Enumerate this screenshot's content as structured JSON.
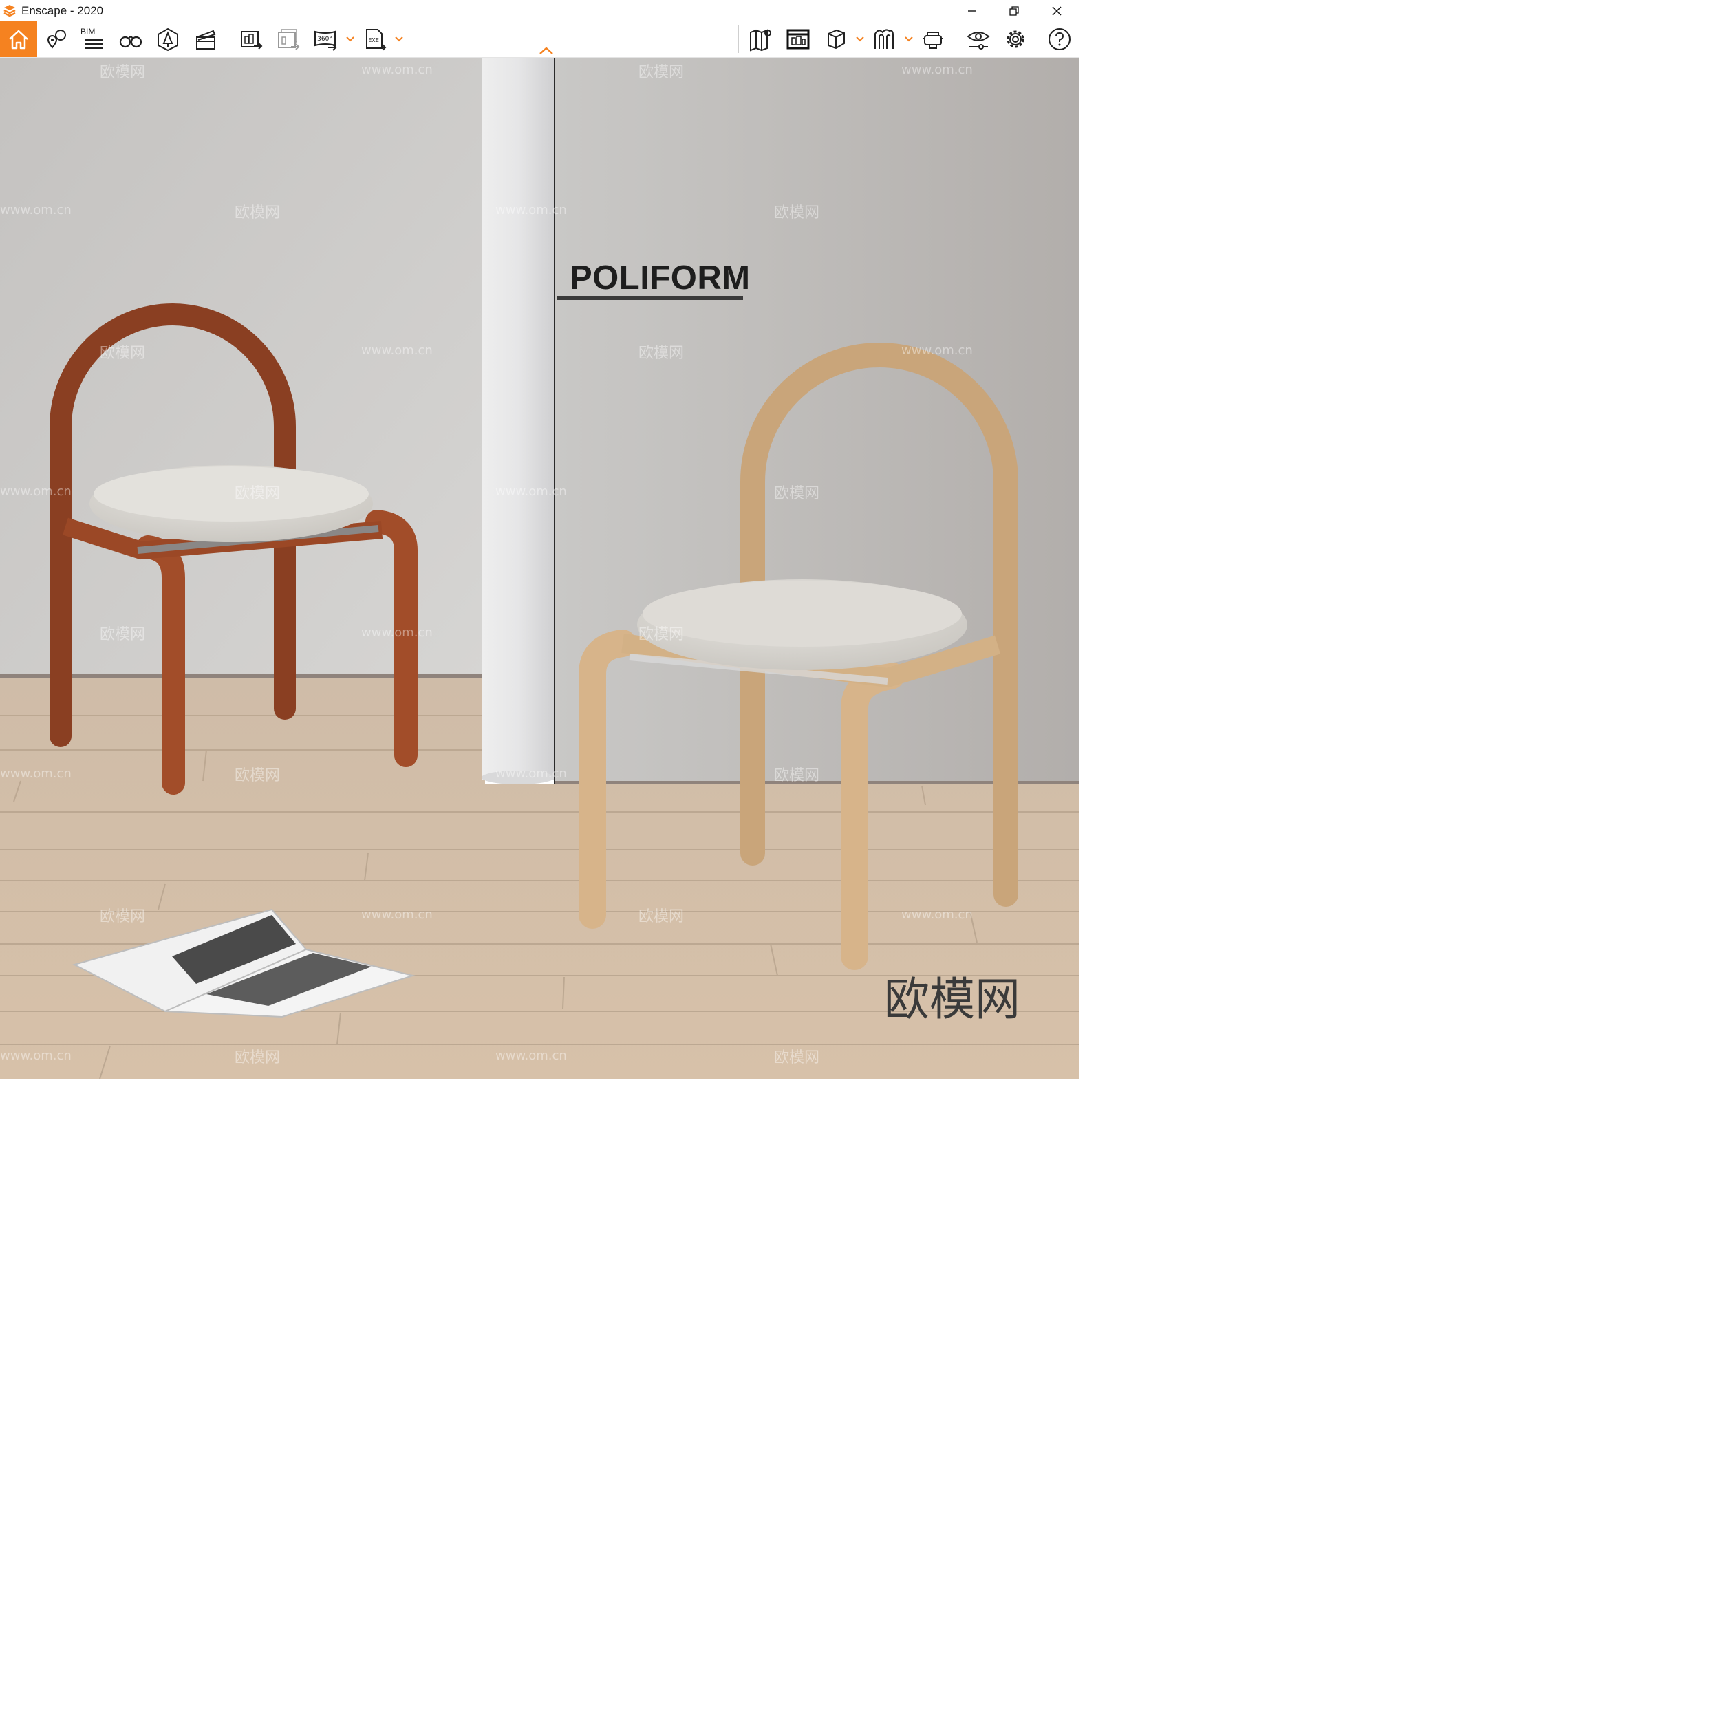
{
  "window": {
    "title": "Enscape - 2020",
    "controls": [
      "minimize",
      "restore",
      "close"
    ]
  },
  "toolbar": {
    "bim_label": "BIM",
    "tools_left": [
      {
        "name": "home",
        "active": true
      },
      {
        "name": "views"
      },
      {
        "name": "bim-info"
      },
      {
        "name": "walk-mode"
      },
      {
        "name": "asset-library"
      },
      {
        "name": "video-editor"
      },
      {
        "name": "render-screenshot"
      },
      {
        "name": "batch-render"
      },
      {
        "name": "render-panorama",
        "has_dropdown": true
      },
      {
        "name": "export-exe",
        "has_dropdown": true
      }
    ],
    "tools_right": [
      {
        "name": "map"
      },
      {
        "name": "upload"
      },
      {
        "name": "orthographic",
        "has_dropdown": true
      },
      {
        "name": "section",
        "has_dropdown": true
      },
      {
        "name": "vr-headset"
      },
      {
        "name": "visual-settings"
      },
      {
        "name": "general-settings"
      },
      {
        "name": "help"
      }
    ],
    "accent_color": "#f58220"
  },
  "scene": {
    "brand_text": "POLIFORM",
    "watermark_text": "欧模网",
    "watermark_url": "www.om.cn",
    "big_watermark": "欧模网"
  }
}
